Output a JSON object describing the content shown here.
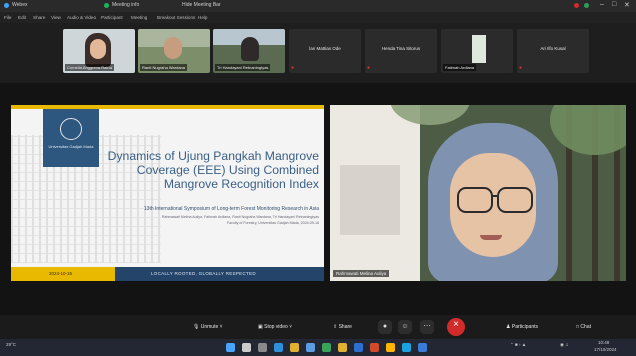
{
  "window": {
    "title_items": [
      "Webex",
      "Meeting info",
      "Hide Meeting Bar"
    ],
    "menu": [
      "File",
      "Edit",
      "Share",
      "View",
      "Audio & Video",
      "Participant",
      "Meeting",
      "Breakout Sessions",
      "Help"
    ]
  },
  "participants": [
    {
      "name": "Cornelia Anggrena Ratna",
      "type": "video"
    },
    {
      "name": "Ranti Nugraha Wardana",
      "type": "video"
    },
    {
      "name": "Tri Handayani Retnaningtyas",
      "type": "video"
    },
    {
      "name": "lan Mattias Ode",
      "type": "name"
    },
    {
      "name": "Henda Tina Sitorus",
      "type": "name"
    },
    {
      "name": "Fatimah Ardiana",
      "type": "image"
    },
    {
      "name": "Ari Ilfo Kusal",
      "type": "name"
    }
  ],
  "slide": {
    "university": "Universitas Gadjah Mada",
    "title": "Dynamics of Ujung Pangkah Mangrove Coverage (EEE) Using Combined Mangrove Recognition Index",
    "subtitle": "13th International Symposium of Long-term Forest Monitoring Research in Asia",
    "authors_1": "Rahmawati Melina Auliya, Fatimah Ardiana, Ranti Nugraha Wardana, Tri Handayani Retnaningtyas",
    "authors_2": "Faculty of Forestry, Universitas Gadjah Mada, 2024-09-18",
    "date": "2024-10-15",
    "motto": "LOCALLY ROOTED, GLOBALLY RESPECTED"
  },
  "speaker": {
    "name": "Rahmawati Melina Auliya"
  },
  "controls": {
    "unmute": "Unmute",
    "stop_video": "Stop video",
    "share": "Share",
    "participants": "Participants",
    "chat": "Chat"
  },
  "taskbar": {
    "weather": "29°C",
    "time": "10:48",
    "date": "17/10/2024"
  },
  "colors": {
    "slide_accent": "#e9b800",
    "slide_blue": "#24446a",
    "leave_red": "#d12b2b"
  }
}
